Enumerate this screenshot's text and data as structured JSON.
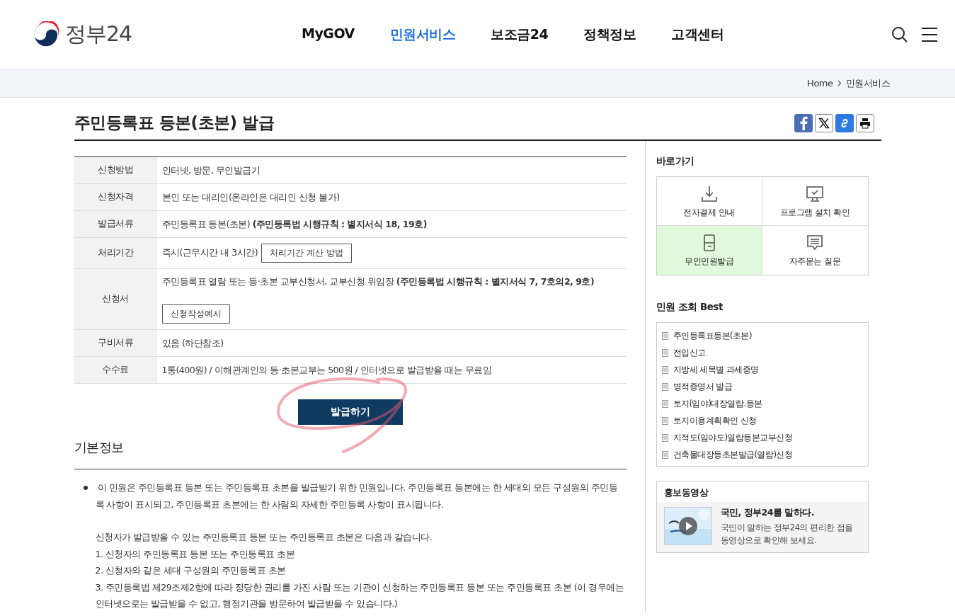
{
  "header": {
    "logo": "정부24",
    "nav": [
      {
        "label": "MyGOV",
        "selected": false
      },
      {
        "label": "민원서비스",
        "selected": true
      },
      {
        "label": "보조금24",
        "selected": false
      },
      {
        "label": "정책정보",
        "selected": false
      },
      {
        "label": "고객센터",
        "selected": false
      }
    ]
  },
  "breadcrumb": [
    "Home",
    "민원서비스"
  ],
  "title": "주민등록표 등본(초본) 발급",
  "table": {
    "rows": [
      {
        "label": "신청방법",
        "value": "인터넷, 방문, 무인발급기"
      },
      {
        "label": "신청자격",
        "value": "본인 또는 대리인(온라인은 대리인 신청 불가)"
      },
      {
        "label": "발급서류",
        "value": "주민등록표 등본(초본) **(주민등록법 시행규칙 : 별지서식 18, 19호)**"
      },
      {
        "label": "처리기간",
        "value": "즉시(근무시간 내 3시간)",
        "button": "처리기간 계산 방법",
        "kind": "inline"
      },
      {
        "label": "신청서",
        "value": "주민등록표 열람 또는 등·초본 교부신청서, 교부신청 위임장 **(주민등록법 시행규칙 : 별지서식 7, 7호의2, 9호)**",
        "button": "신청작성예시",
        "kind": "below"
      },
      {
        "label": "구비서류",
        "value": "있음 (하단참조)"
      },
      {
        "label": "수수료",
        "value": "1통(400원) / 이해관계인의 등·초본교부는 500원 / 인터넷으로 발급받을 때는 무료임"
      }
    ]
  },
  "apply_button": "발급하기",
  "basic_info": {
    "heading": "기본정보",
    "paragraphs": [
      "이 민원은 주민등록표 등본 또는 주민등록표 초본을 발급받기 위한 민원입니다. 주민등록표 등본에는 한 세대의 모든 구성원의 주민등록 사항이 표시되고, 주민등록표 초본에는 한 사람의 자세한 주민등록 사항이 표시됩니다.",
      "신청자가 발급받을 수 있는 주민등록표 등본 또는 주민등록표 초본은 다음과 같습니다.",
      "1. 신청자의 주민등록표 등본 또는 주민등록표 초본",
      "2. 신청자와 같은 세대 구성원의 주민등록표 초본",
      "3. 주민등록법 제29조제2항에 따라 정당한 권리를 가진 사람 또는 기관이 신청하는 주민등록표 등본 또는 주민등록표 초본 (이 경우에는 인터넷으로는 발급받을 수 없고, 행정기관을 방문하여 발급받을 수 있습니다.)"
    ]
  },
  "sidebar": {
    "quick_heading": "바로가기",
    "quick_links": [
      {
        "label": "전자결제 안내",
        "kind": "download",
        "selected": false
      },
      {
        "label": "프로그램 설치 확인",
        "kind": "monitor",
        "selected": false
      },
      {
        "label": "무인민원발급",
        "kind": "kiosk",
        "selected": true
      },
      {
        "label": "자주묻는 질문",
        "kind": "chat",
        "selected": false
      }
    ],
    "best_heading": "민원 조회 Best",
    "best_items": [
      "주민등록표등본(초본)",
      "전입신고",
      "지방세 세목별 과세증명",
      "병적증명서 발급",
      "토지(임야)대장열람.등본",
      "토지이용계획확인 신청",
      "지적도(임야도)열람등본교부신청",
      "건축물대장등초본발급(열람)신청"
    ],
    "video": {
      "heading": "홍보동영상",
      "title": "국민, 정부24를 말하다.",
      "description": "국민이 말하는 정부24의 편리한 점을 동영상으로 확인해 보세요."
    }
  }
}
